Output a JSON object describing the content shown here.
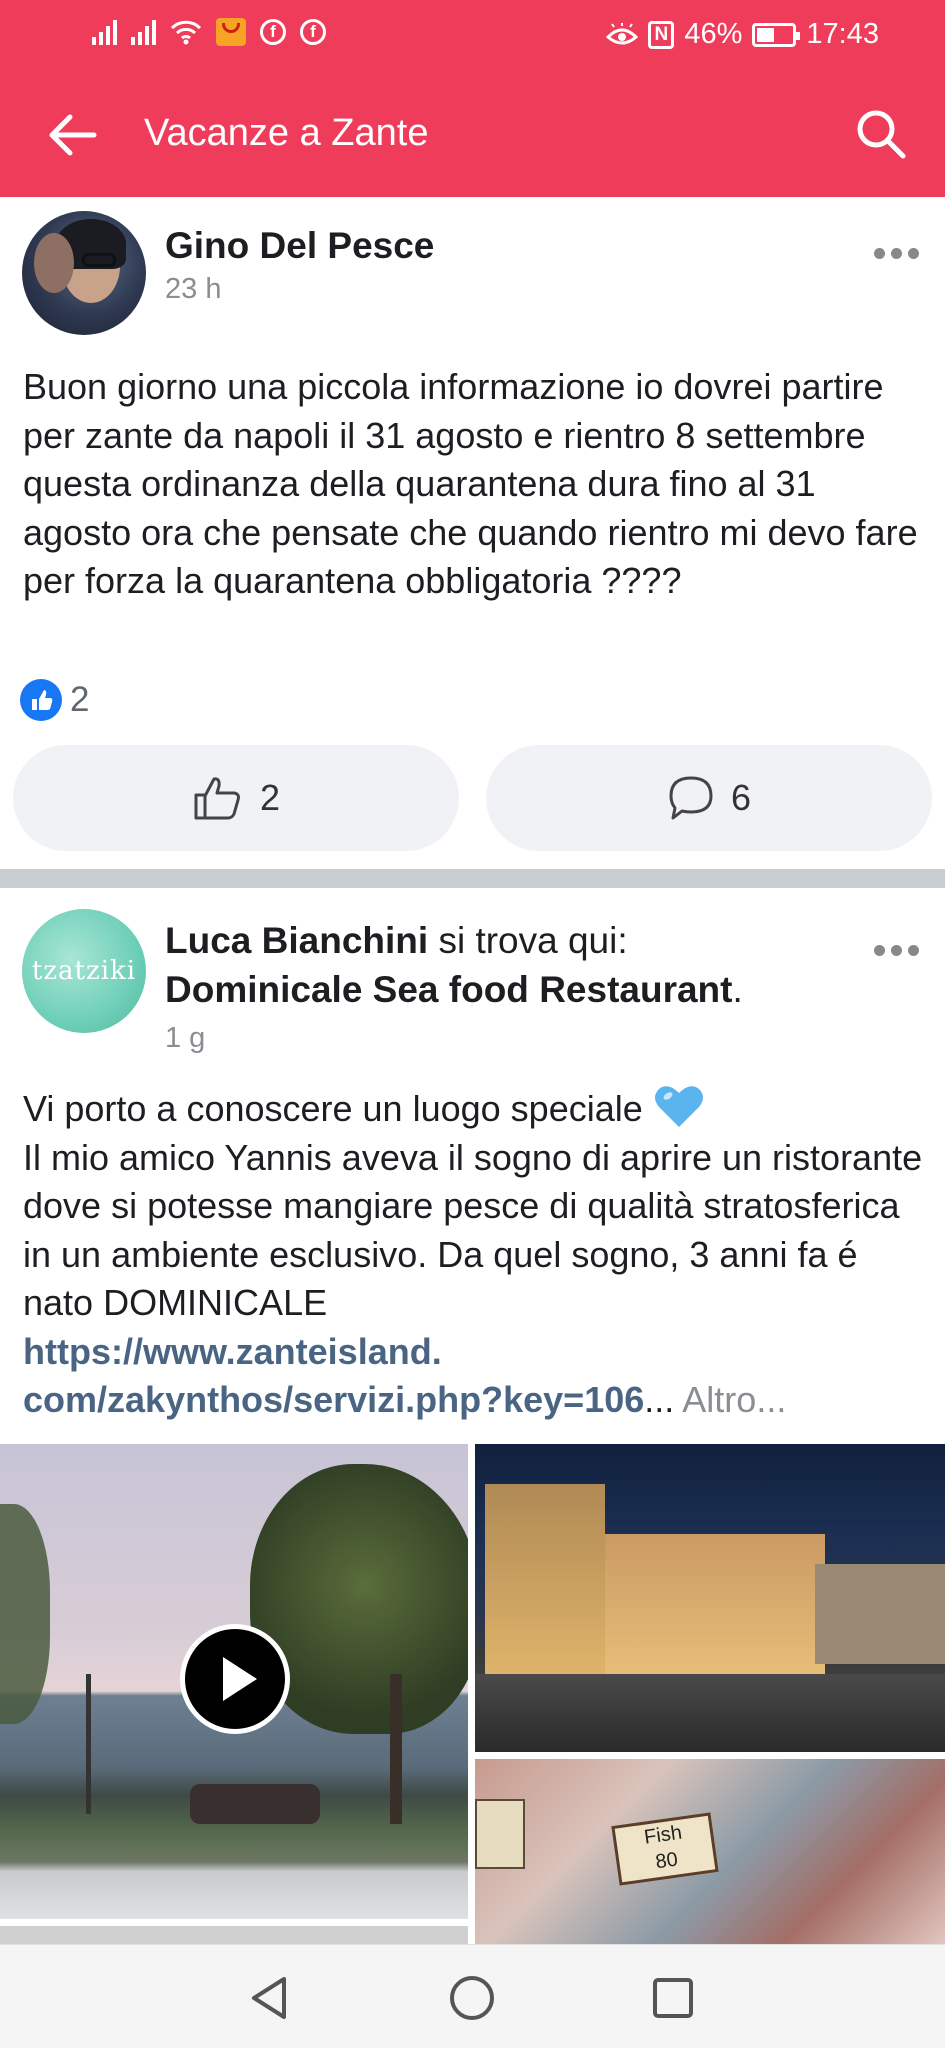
{
  "status_bar": {
    "battery": "46%",
    "time": "17:43"
  },
  "app_bar": {
    "title": "Vacanze a Zante"
  },
  "post1": {
    "author": "Gino Del Pesce",
    "time": "23 h",
    "text": "Buon giorno una piccola informazione io dovrei partire per zante da napoli il 31 agosto e rientro 8 settembre questa ordinanza della quarantena dura fino al 31 agosto ora che pensate che quando rientro mi devo fare per forza la quarantena obbligatoria ????",
    "reaction_count": "2",
    "like_count": "2",
    "comment_count": "6"
  },
  "post2": {
    "author": "Luca Bianchini",
    "checkin_text": "si trova qui:",
    "place": "Dominicale Sea food Restaurant",
    "place_period": ".",
    "time": "1 g",
    "avatar_text": "tzatziki",
    "line1": "Vi porto a conoscere un luogo speciale",
    "line2": "Il mio amico Yannis aveva il sogno di aprire un ristorante dove si potesse mangiare pesce di qualità stratosferica in un ambiente esclusivo. Da quel sogno, 3 anni fa é nato DOMINICALE",
    "link1": "https://www.zanteisland.",
    "link2": "com/zakynthos/servizi.php?key=106",
    "ellipsis": "...",
    "more": "Altro...",
    "photo_labels": [
      "Fish",
      "80"
    ]
  },
  "icons": [
    "back-arrow-icon",
    "search-icon",
    "more-icon",
    "like-icon",
    "comment-icon",
    "blue-heart-icon",
    "play-icon",
    "nav-back-icon",
    "nav-home-icon",
    "nav-recents-icon"
  ]
}
